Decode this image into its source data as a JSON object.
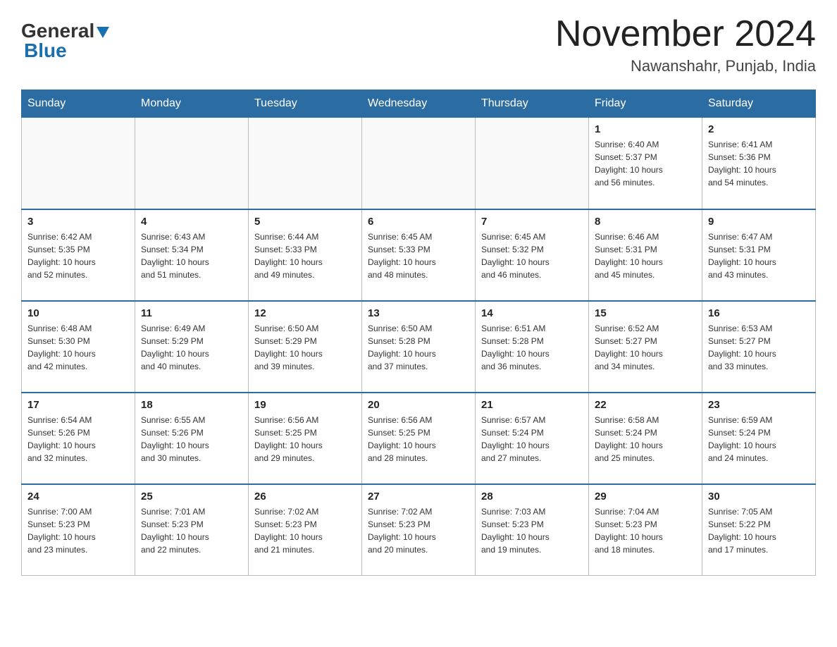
{
  "logo": {
    "text_general": "General",
    "text_blue": "Blue"
  },
  "header": {
    "month_year": "November 2024",
    "location": "Nawanshahr, Punjab, India"
  },
  "weekdays": [
    "Sunday",
    "Monday",
    "Tuesday",
    "Wednesday",
    "Thursday",
    "Friday",
    "Saturday"
  ],
  "weeks": [
    [
      {
        "day": "",
        "info": ""
      },
      {
        "day": "",
        "info": ""
      },
      {
        "day": "",
        "info": ""
      },
      {
        "day": "",
        "info": ""
      },
      {
        "day": "",
        "info": ""
      },
      {
        "day": "1",
        "info": "Sunrise: 6:40 AM\nSunset: 5:37 PM\nDaylight: 10 hours\nand 56 minutes."
      },
      {
        "day": "2",
        "info": "Sunrise: 6:41 AM\nSunset: 5:36 PM\nDaylight: 10 hours\nand 54 minutes."
      }
    ],
    [
      {
        "day": "3",
        "info": "Sunrise: 6:42 AM\nSunset: 5:35 PM\nDaylight: 10 hours\nand 52 minutes."
      },
      {
        "day": "4",
        "info": "Sunrise: 6:43 AM\nSunset: 5:34 PM\nDaylight: 10 hours\nand 51 minutes."
      },
      {
        "day": "5",
        "info": "Sunrise: 6:44 AM\nSunset: 5:33 PM\nDaylight: 10 hours\nand 49 minutes."
      },
      {
        "day": "6",
        "info": "Sunrise: 6:45 AM\nSunset: 5:33 PM\nDaylight: 10 hours\nand 48 minutes."
      },
      {
        "day": "7",
        "info": "Sunrise: 6:45 AM\nSunset: 5:32 PM\nDaylight: 10 hours\nand 46 minutes."
      },
      {
        "day": "8",
        "info": "Sunrise: 6:46 AM\nSunset: 5:31 PM\nDaylight: 10 hours\nand 45 minutes."
      },
      {
        "day": "9",
        "info": "Sunrise: 6:47 AM\nSunset: 5:31 PM\nDaylight: 10 hours\nand 43 minutes."
      }
    ],
    [
      {
        "day": "10",
        "info": "Sunrise: 6:48 AM\nSunset: 5:30 PM\nDaylight: 10 hours\nand 42 minutes."
      },
      {
        "day": "11",
        "info": "Sunrise: 6:49 AM\nSunset: 5:29 PM\nDaylight: 10 hours\nand 40 minutes."
      },
      {
        "day": "12",
        "info": "Sunrise: 6:50 AM\nSunset: 5:29 PM\nDaylight: 10 hours\nand 39 minutes."
      },
      {
        "day": "13",
        "info": "Sunrise: 6:50 AM\nSunset: 5:28 PM\nDaylight: 10 hours\nand 37 minutes."
      },
      {
        "day": "14",
        "info": "Sunrise: 6:51 AM\nSunset: 5:28 PM\nDaylight: 10 hours\nand 36 minutes."
      },
      {
        "day": "15",
        "info": "Sunrise: 6:52 AM\nSunset: 5:27 PM\nDaylight: 10 hours\nand 34 minutes."
      },
      {
        "day": "16",
        "info": "Sunrise: 6:53 AM\nSunset: 5:27 PM\nDaylight: 10 hours\nand 33 minutes."
      }
    ],
    [
      {
        "day": "17",
        "info": "Sunrise: 6:54 AM\nSunset: 5:26 PM\nDaylight: 10 hours\nand 32 minutes."
      },
      {
        "day": "18",
        "info": "Sunrise: 6:55 AM\nSunset: 5:26 PM\nDaylight: 10 hours\nand 30 minutes."
      },
      {
        "day": "19",
        "info": "Sunrise: 6:56 AM\nSunset: 5:25 PM\nDaylight: 10 hours\nand 29 minutes."
      },
      {
        "day": "20",
        "info": "Sunrise: 6:56 AM\nSunset: 5:25 PM\nDaylight: 10 hours\nand 28 minutes."
      },
      {
        "day": "21",
        "info": "Sunrise: 6:57 AM\nSunset: 5:24 PM\nDaylight: 10 hours\nand 27 minutes."
      },
      {
        "day": "22",
        "info": "Sunrise: 6:58 AM\nSunset: 5:24 PM\nDaylight: 10 hours\nand 25 minutes."
      },
      {
        "day": "23",
        "info": "Sunrise: 6:59 AM\nSunset: 5:24 PM\nDaylight: 10 hours\nand 24 minutes."
      }
    ],
    [
      {
        "day": "24",
        "info": "Sunrise: 7:00 AM\nSunset: 5:23 PM\nDaylight: 10 hours\nand 23 minutes."
      },
      {
        "day": "25",
        "info": "Sunrise: 7:01 AM\nSunset: 5:23 PM\nDaylight: 10 hours\nand 22 minutes."
      },
      {
        "day": "26",
        "info": "Sunrise: 7:02 AM\nSunset: 5:23 PM\nDaylight: 10 hours\nand 21 minutes."
      },
      {
        "day": "27",
        "info": "Sunrise: 7:02 AM\nSunset: 5:23 PM\nDaylight: 10 hours\nand 20 minutes."
      },
      {
        "day": "28",
        "info": "Sunrise: 7:03 AM\nSunset: 5:23 PM\nDaylight: 10 hours\nand 19 minutes."
      },
      {
        "day": "29",
        "info": "Sunrise: 7:04 AM\nSunset: 5:23 PM\nDaylight: 10 hours\nand 18 minutes."
      },
      {
        "day": "30",
        "info": "Sunrise: 7:05 AM\nSunset: 5:22 PM\nDaylight: 10 hours\nand 17 minutes."
      }
    ]
  ]
}
